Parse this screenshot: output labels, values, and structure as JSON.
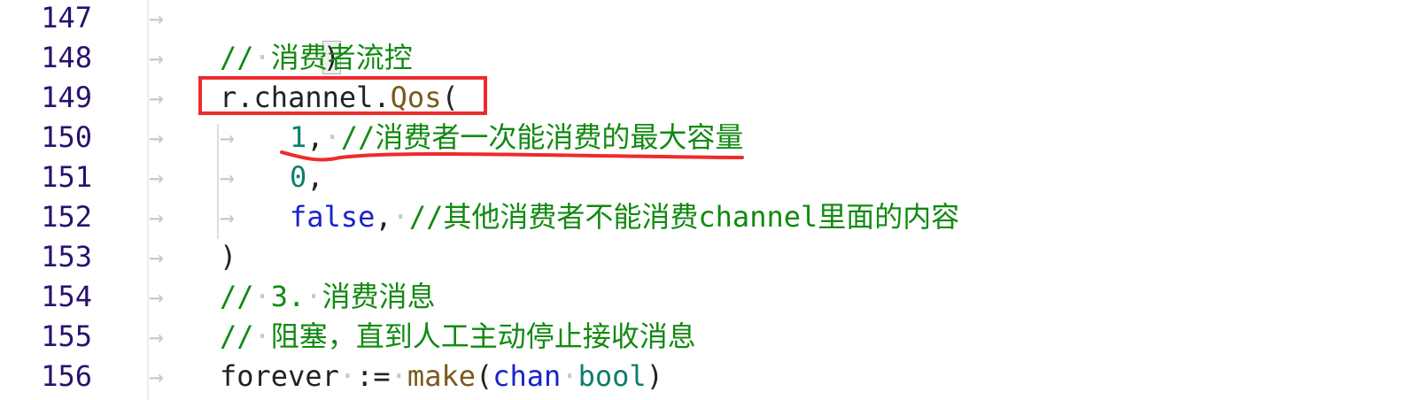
{
  "editor": {
    "whitespace_glyph": "→",
    "space_dot": "·",
    "lines": [
      {
        "num": "147",
        "paren": ")"
      },
      {
        "num": "148",
        "comment_prefix": "//",
        "comment_text": "消费者流控"
      },
      {
        "num": "149",
        "obj": "r.channel.",
        "method": "Qos",
        "open": "("
      },
      {
        "num": "150",
        "value": "1",
        "sep": ",",
        "comment": "//消费者一次能消费的最大容量"
      },
      {
        "num": "151",
        "value": "0",
        "sep": ","
      },
      {
        "num": "152",
        "value": "false",
        "sep": ",",
        "comment": "//其他消费者不能消费channel里面的内容"
      },
      {
        "num": "153",
        "paren": ")"
      },
      {
        "num": "154",
        "comment_prefix": "//",
        "comment_text": "3.",
        "comment_text2": "消费消息"
      },
      {
        "num": "155",
        "comment_prefix": "//",
        "comment_text": "阻塞，直到人工主动停止接收消息"
      },
      {
        "num": "156",
        "var": "forever",
        "assign": ":=",
        "fn": "make",
        "open": "(",
        "kw1": "chan",
        "kw2": "bool",
        "close": ")"
      }
    ]
  },
  "annotation": {
    "box_color": "#ee2b2b",
    "underline_color": "#ee2b2b"
  }
}
